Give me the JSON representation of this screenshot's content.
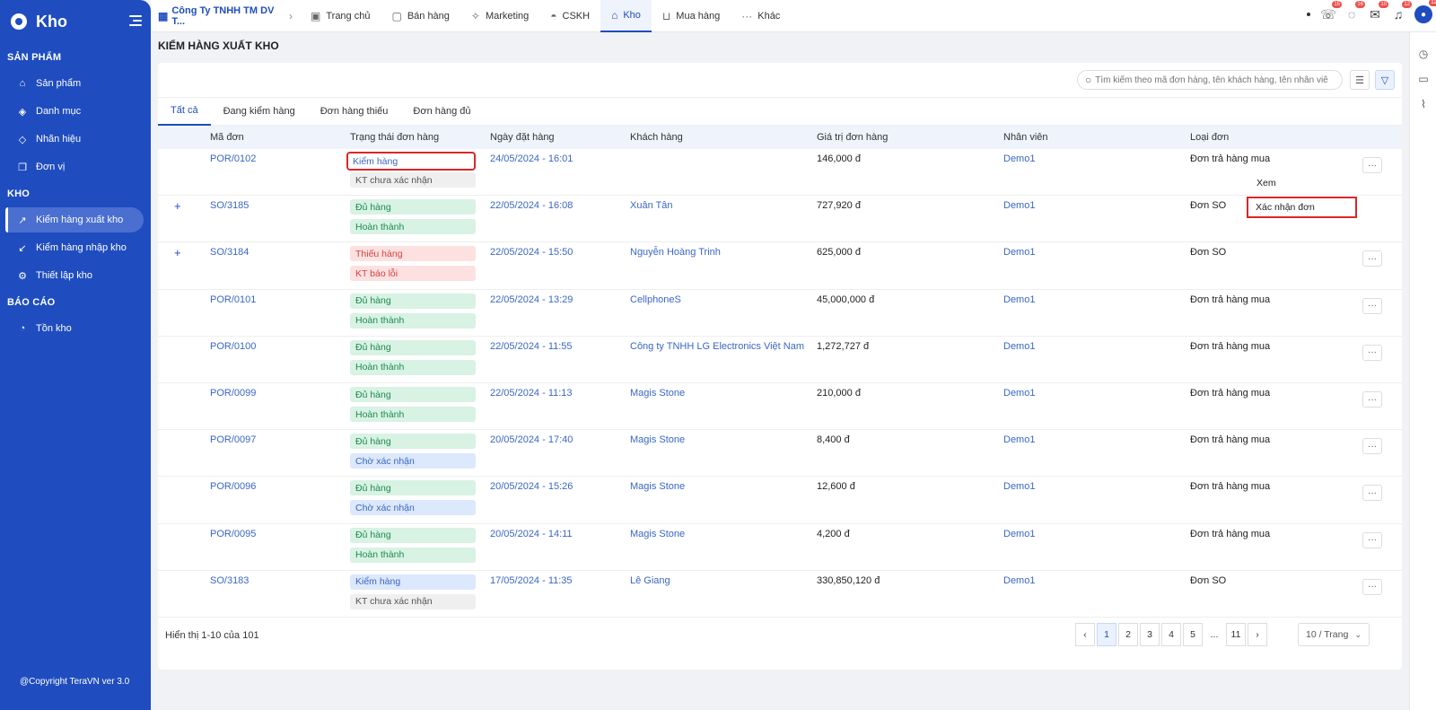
{
  "sidebar": {
    "brand": "Kho",
    "sections": [
      {
        "title": "SẢN PHẨM",
        "items": [
          {
            "label": "Sản phẩm",
            "icon": "bag-icon"
          },
          {
            "label": "Danh mục",
            "icon": "layers-icon"
          },
          {
            "label": "Nhãn hiệu",
            "icon": "tag-icon"
          },
          {
            "label": "Đơn vị",
            "icon": "copy-icon"
          }
        ]
      },
      {
        "title": "KHO",
        "items": [
          {
            "label": "Kiểm hàng xuất kho",
            "icon": "arrow-up-right-icon",
            "active": true
          },
          {
            "label": "Kiểm hàng nhập kho",
            "icon": "arrow-down-left-icon"
          },
          {
            "label": "Thiết lập kho",
            "icon": "gear-icon"
          }
        ]
      },
      {
        "title": "BÁO CÁO",
        "items": [
          {
            "label": "Tồn kho",
            "icon": "pie-chart-icon"
          }
        ]
      }
    ],
    "footer": "@Copyright TeraVN ver 3.0"
  },
  "topbar": {
    "company": "Công Ty TNHH TM DV T...",
    "tabs": [
      {
        "label": "Trang chủ",
        "icon": "dashboard-icon"
      },
      {
        "label": "Bán hàng",
        "icon": "box-icon"
      },
      {
        "label": "Marketing",
        "icon": "sparkle-icon"
      },
      {
        "label": "CSKH",
        "icon": "headset-icon"
      },
      {
        "label": "Kho",
        "icon": "home-icon",
        "active": true
      },
      {
        "label": "Mua hàng",
        "icon": "cart-icon"
      },
      {
        "label": "Khác",
        "icon": "more-horizontal-icon"
      }
    ],
    "badges": {
      "phone": "15",
      "chat": "16",
      "mail": "10",
      "bell": "12",
      "avatar": "12"
    }
  },
  "page": {
    "title": "KIỂM HÀNG XUẤT KHO",
    "search_placeholder": "Tìm kiếm theo mã đơn hàng, tên khách hàng, tên nhân viên"
  },
  "tabs": [
    "Tất cả",
    "Đang kiểm hàng",
    "Đơn hàng thiếu",
    "Đơn hàng đủ"
  ],
  "table": {
    "columns": [
      "Mã đơn",
      "Trạng thái đơn hàng",
      "Ngày đặt hàng",
      "Khách hàng",
      "Giá trị đơn hàng",
      "Nhân viên",
      "Loại đơn"
    ],
    "rows": [
      {
        "code": "POR/0102",
        "s1": "Kiểm hàng",
        "s2": "KT chưa xác nhận",
        "date": "24/05/2024 - 16:01",
        "customer": "",
        "value": "146,000 đ",
        "staff": "Demo1",
        "type": "Đơn trả hàng mua"
      },
      {
        "code": "SO/3185",
        "s1": "Đủ hàng",
        "s2": "Hoàn thành",
        "date": "22/05/2024 - 16:08",
        "customer": "Xuân Tân",
        "value": "727,920 đ",
        "staff": "Demo1",
        "type": "Đơn SO"
      },
      {
        "code": "SO/3184",
        "s1": "Thiếu hàng",
        "s2": "KT báo lỗi",
        "date": "22/05/2024 - 15:50",
        "customer": "Nguyễn Hoàng Trinh",
        "value": "625,000 đ",
        "staff": "Demo1",
        "type": "Đơn SO"
      },
      {
        "code": "POR/0101",
        "s1": "Đủ hàng",
        "s2": "Hoàn thành",
        "date": "22/05/2024 - 13:29",
        "customer": "CellphoneS",
        "value": "45,000,000 đ",
        "staff": "Demo1",
        "type": "Đơn trả hàng mua"
      },
      {
        "code": "POR/0100",
        "s1": "Đủ hàng",
        "s2": "Hoàn thành",
        "date": "22/05/2024 - 11:55",
        "customer": "Công ty TNHH LG Electronics Việt Nam",
        "value": "1,272,727 đ",
        "staff": "Demo1",
        "type": "Đơn trả hàng mua"
      },
      {
        "code": "POR/0099",
        "s1": "Đủ hàng",
        "s2": "Hoàn thành",
        "date": "22/05/2024 - 11:13",
        "customer": "Magis Stone",
        "value": "210,000 đ",
        "staff": "Demo1",
        "type": "Đơn trả hàng mua"
      },
      {
        "code": "POR/0097",
        "s1": "Đủ hàng",
        "s2": "Chờ xác nhận",
        "date": "20/05/2024 - 17:40",
        "customer": "Magis Stone",
        "value": "8,400 đ",
        "staff": "Demo1",
        "type": "Đơn trả hàng mua"
      },
      {
        "code": "POR/0096",
        "s1": "Đủ hàng",
        "s2": "Chờ xác nhận",
        "date": "20/05/2024 - 15:26",
        "customer": "Magis Stone",
        "value": "12,600 đ",
        "staff": "Demo1",
        "type": "Đơn trả hàng mua"
      },
      {
        "code": "POR/0095",
        "s1": "Đủ hàng",
        "s2": "Hoàn thành",
        "date": "20/05/2024 - 14:11",
        "customer": "Magis Stone",
        "value": "4,200 đ",
        "staff": "Demo1",
        "type": "Đơn trả hàng mua"
      },
      {
        "code": "SO/3183",
        "s1": "Kiểm hàng",
        "s2": "KT chưa xác nhận",
        "date": "17/05/2024 - 11:35",
        "customer": "Lê Giang",
        "value": "330,850,120 đ",
        "staff": "Demo1",
        "type": "Đơn SO"
      }
    ]
  },
  "dropdown": {
    "view": "Xem",
    "confirm": "Xác nhận đơn"
  },
  "pagination": {
    "info": "Hiển thị 1-10 của 101",
    "pages": [
      "1",
      "2",
      "3",
      "4",
      "5",
      "...",
      "11"
    ],
    "page_size": "10 / Trang"
  }
}
